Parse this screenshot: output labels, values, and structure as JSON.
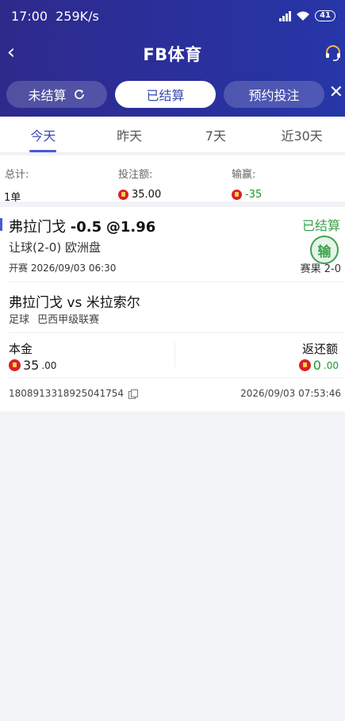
{
  "status": {
    "time": "17:00",
    "speed": "259K/s",
    "battery": "41"
  },
  "header": {
    "title": "FB体育",
    "back_icon": "chevron-left-icon",
    "support_icon": "headset-icon"
  },
  "top_tabs": [
    {
      "label": "未结算",
      "icon": "refresh-icon"
    },
    {
      "label": "已结算",
      "active": true
    },
    {
      "label": "预约投注"
    }
  ],
  "date_tabs": [
    "今天",
    "昨天",
    "7天",
    "近30天"
  ],
  "summary": {
    "total_label": "总计:",
    "total_value": "1单",
    "stake_label": "投注额:",
    "stake_value": "35.00",
    "winloss_label": "输赢:",
    "winloss_value": "-35"
  },
  "bet": {
    "team": "弗拉门戈",
    "handicap": "-0.5",
    "odds": "@1.96",
    "status": "已结算",
    "stamp": "输",
    "market": "让球(2-0) 欧洲盘",
    "open_label": "开赛",
    "open_time": "2026/09/03 06:30",
    "score_label": "赛果",
    "score": "2-0",
    "match": "弗拉门戈 vs 米拉索尔",
    "sport": "足球",
    "league": "巴西甲级联赛",
    "stake_label": "本金",
    "stake_int": "35",
    "stake_dec": ".00",
    "return_label": "返还额",
    "return_int": "0",
    "return_dec": ".00",
    "order_id": "1808913318925041754",
    "order_time": "2026/09/03 07:53:46"
  },
  "colors": {
    "header": "#2e2a8c",
    "accent": "#3a49b4",
    "win": "#1a9a2b"
  }
}
